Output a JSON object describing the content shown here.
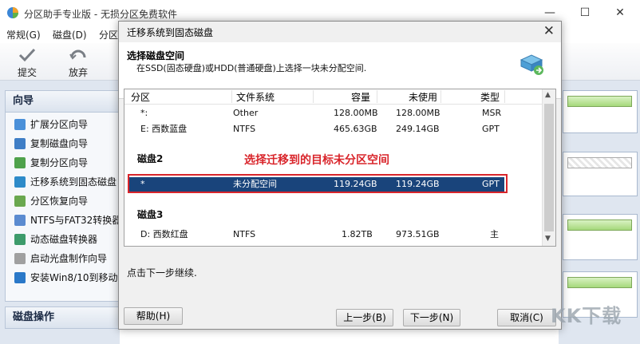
{
  "window": {
    "title": "分区助手专业版 - 无损分区免费软件",
    "controls": [
      "—",
      "☐",
      "✕"
    ]
  },
  "menu": [
    "常规(G)",
    "磁盘(D)",
    "分区"
  ],
  "toolbar": [
    {
      "label": "提交",
      "icon": "check-icon"
    },
    {
      "label": "放弃",
      "icon": "discard-icon"
    }
  ],
  "sidebar": {
    "wizard_title": "向导",
    "wizards": [
      {
        "label": "扩展分区向导",
        "icon": "expand-icon",
        "color": "#4a90d9"
      },
      {
        "label": "复制磁盘向导",
        "icon": "copy-disk-icon",
        "color": "#3f7ec6"
      },
      {
        "label": "复制分区向导",
        "icon": "copy-partition-icon",
        "color": "#4fa24b"
      },
      {
        "label": "迁移系统到固态磁盘",
        "icon": "migrate-icon",
        "color": "#2e8bc9"
      },
      {
        "label": "分区恢复向导",
        "icon": "recover-icon",
        "color": "#6aa84f"
      },
      {
        "label": "NTFS与FAT32转换器",
        "icon": "convert-icon",
        "color": "#5b8bd0"
      },
      {
        "label": "动态磁盘转换器",
        "icon": "dynamic-disk-icon",
        "color": "#3d9b6b"
      },
      {
        "label": "启动光盘制作向导",
        "icon": "bootcd-icon",
        "color": "#a0a0a0"
      },
      {
        "label": "安装Win8/10到移动",
        "icon": "windows-icon",
        "color": "#2a78c8"
      }
    ],
    "disk_ops_title": "磁盘操作"
  },
  "dialog": {
    "title": "迁移系统到固态磁盘",
    "close": "✕",
    "heading": "选择磁盘空间",
    "subheading": "在SSD(固态硬盘)或HDD(普通硬盘)上选择一块未分配空间.",
    "columns": [
      "分区",
      "文件系统",
      "容量",
      "未使用",
      "类型"
    ],
    "disk1_rows": [
      {
        "partition": "*:",
        "fs": "Other",
        "capacity": "128.00MB",
        "free": "128.00MB",
        "type": "MSR"
      },
      {
        "partition": "E:  西数蓝盘",
        "fs": "NTFS",
        "capacity": "465.63GB",
        "free": "249.14GB",
        "type": "GPT"
      }
    ],
    "disk2_label": "磁盘2",
    "disk2_rows": [
      {
        "partition": "*",
        "fs": "未分配空间",
        "capacity": "119.24GB",
        "free": "119.24GB",
        "type": "GPT"
      }
    ],
    "disk3_label": "磁盘3",
    "disk3_rows": [
      {
        "partition": "D:  西数红盘",
        "fs": "NTFS",
        "capacity": "1.82TB",
        "free": "973.51GB",
        "type": "主"
      }
    ],
    "annotation": "选择迁移到的目标未分区空间",
    "message": "点击下一步继续.",
    "buttons": {
      "help": "帮助(H)",
      "prev": "上一步(B)",
      "next": "下一步(N)",
      "cancel": "取消(C)"
    }
  },
  "watermark": "KK下载",
  "colors": {
    "selection": "#19447b",
    "annotation": "#d9252b",
    "sidebar": "#dfe6f0"
  }
}
